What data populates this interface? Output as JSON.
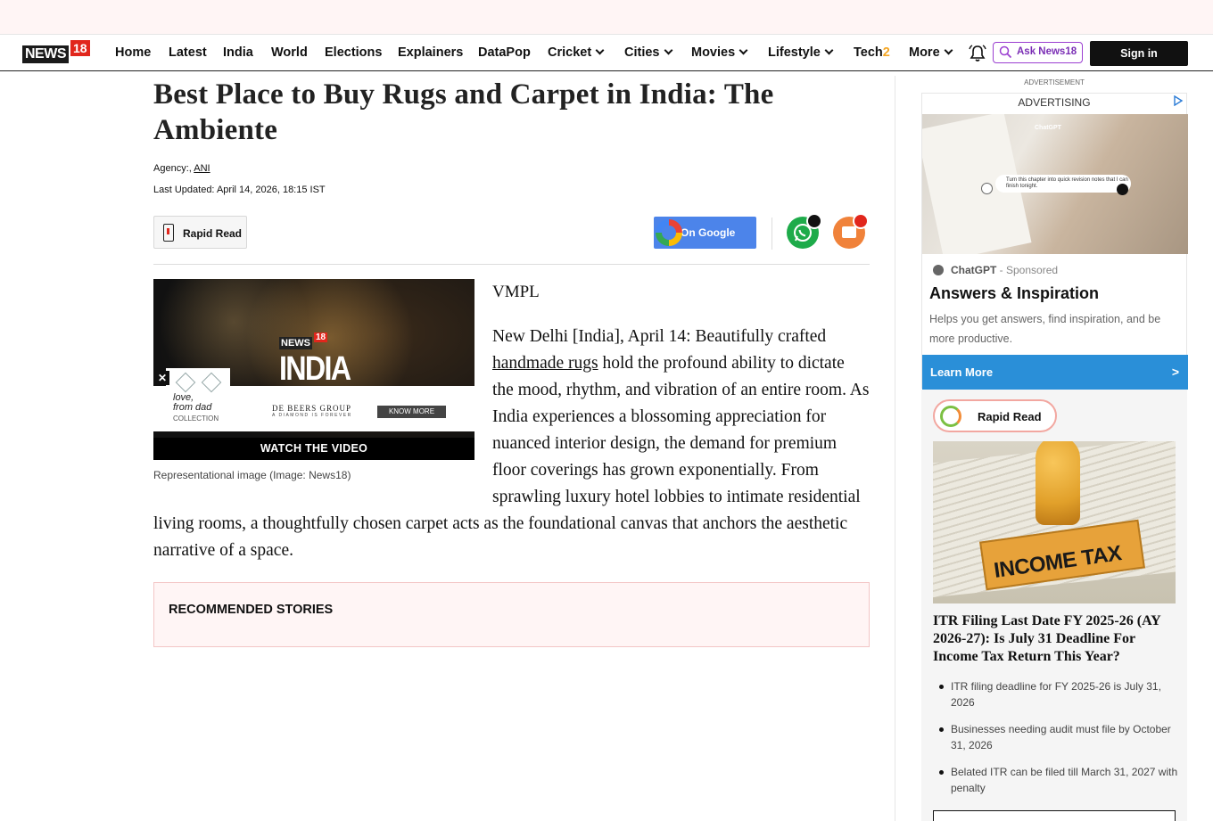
{
  "site": {
    "logo_main": "NEWS",
    "logo_num": "18"
  },
  "nav": {
    "items": [
      {
        "label": "Home"
      },
      {
        "label": "Latest"
      },
      {
        "label": "India"
      },
      {
        "label": "World"
      },
      {
        "label": "Elections"
      },
      {
        "label": "Explainers"
      },
      {
        "label": "DataPop"
      },
      {
        "label": "Cricket"
      },
      {
        "label": "Cities"
      },
      {
        "label": "Movies"
      },
      {
        "label": "Lifestyle"
      },
      {
        "label": "Tech"
      },
      {
        "label": "More"
      }
    ],
    "tech_suffix": "2",
    "ask_label": "Ask News18",
    "signin_label": "Sign in"
  },
  "article": {
    "headline": "Best Place to Buy Rugs and Carpet in India: The Ambiente",
    "agency_label": "Agency:,",
    "agency_name": "ANI",
    "updated_label": "Last Updated:",
    "updated_value": "April 14, 2026, 18:15 IST",
    "rapid_read_label": "Rapid Read",
    "google_label": "On Google",
    "byline": "VMPL",
    "body_before_link": "New Delhi [India], April 14: Beautifully crafted ",
    "body_link": "handmade rugs",
    "body_after_link": " hold the profound ability to dictate the mood, rhythm, and vibration of an entire room. As India experiences a blossoming appreciation for nuanced interior design, the demand for premium floor coverings has grown exponentially. From sprawling luxury hotel lobbies to intimate residential living rooms, a thoughtfully chosen carpet acts as the foundational canvas that anchors the aesthetic narrative of a space.",
    "video": {
      "logo_main": "NEWS",
      "logo_num": "18",
      "title": "INDIA",
      "watch_label": "WATCH THE VIDEO",
      "ad_love": "love,",
      "ad_from_dad": "from dad",
      "ad_collection": "COLLECTION",
      "ad_brand": "DE BEERS GROUP",
      "ad_tagline": "A DIAMOND IS FOREVER",
      "ad_cta": "KNOW MORE",
      "close": "✕"
    },
    "caption": "Representational image (Image: News18)",
    "recommended_label": "RECOMMENDED STORIES"
  },
  "sidebar": {
    "advertisement_small": "ADVERTISEMENT",
    "ad": {
      "header": "ADVERTISING",
      "image_brand": "ChatGPT",
      "image_chip": "Turn this chapter into quick revision notes that I can finish tonight.",
      "source": "ChatGPT",
      "sponsored": " - Sponsored",
      "title": "Answers & Inspiration",
      "description": "Helps you get answers, find inspiration, and be more productive.",
      "cta": "Learn More",
      "cta_arrow": ">"
    },
    "rapid_read": {
      "label": "Rapid Read",
      "image_text": "INCOME TAX",
      "title": "ITR Filing Last Date FY 2025-26 (AY 2026-27): Is July 31 Deadline For Income Tax Return This Year?",
      "points": [
        "ITR filing deadline for FY 2025-26 is July 31, 2026",
        "Businesses needing audit must file by October 31, 2026",
        "Belated ITR can be filed till March 31, 2027 with penalty"
      ]
    }
  },
  "colors": {
    "brand_red": "#e1261c",
    "ask_purple": "#9b3fd1",
    "whatsapp_green": "#1eab4a",
    "cta_blue": "#2a8fd8",
    "google_blue": "#4c84ea"
  }
}
